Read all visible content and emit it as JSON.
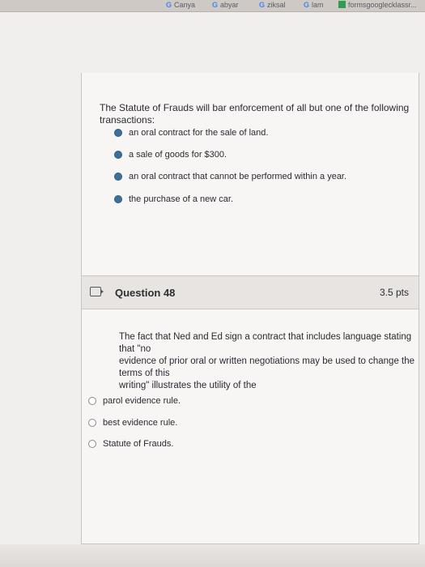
{
  "browser": {
    "bookmarks": [
      "Canya",
      "abyar",
      "ziksal",
      "lam",
      "formsgooglecklassr..."
    ]
  },
  "question_prev": {
    "prompt": "The Statute of Frauds will bar enforcement of all but one of the following transactions:",
    "choices": [
      "an oral contract for the sale of land.",
      "a sale of goods for $300.",
      "an oral contract that cannot be performed within a year.",
      "the purchase of a new car."
    ]
  },
  "question_48": {
    "title": "Question 48",
    "points": "3.5 pts",
    "prompt_lines": [
      "The fact that Ned and Ed sign a contract that includes language stating that \"no",
      "evidence of prior oral or written negotiations may be used to change the terms of this",
      "writing\" illustrates the utility of the"
    ],
    "choices": [
      "parol evidence rule.",
      "best evidence rule.",
      "Statute of Frauds."
    ]
  }
}
